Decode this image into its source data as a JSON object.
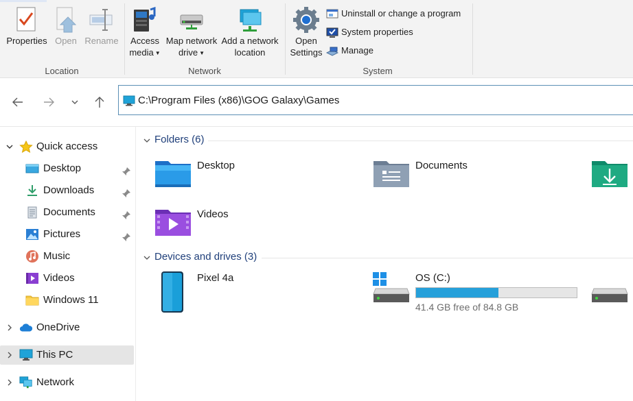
{
  "ribbon": {
    "location": {
      "label": "Location",
      "properties": "Properties",
      "open": "Open",
      "rename": "Rename"
    },
    "network": {
      "label": "Network",
      "access_media_1": "Access",
      "access_media_2": "media",
      "map_drive_1": "Map network",
      "map_drive_2": "drive",
      "add_location_1": "Add a network",
      "add_location_2": "location"
    },
    "system": {
      "label": "System",
      "open_settings_1": "Open",
      "open_settings_2": "Settings",
      "uninstall": "Uninstall or change a program",
      "system_properties": "System properties",
      "manage": "Manage"
    }
  },
  "address": {
    "path": "C:\\Program Files (x86)\\GOG Galaxy\\Games"
  },
  "nav": {
    "quick_access": "Quick access",
    "items": [
      {
        "label": "Desktop",
        "icon": "desktop-icon",
        "pinned": true
      },
      {
        "label": "Downloads",
        "icon": "downloads-icon",
        "pinned": true
      },
      {
        "label": "Documents",
        "icon": "documents-icon",
        "pinned": true
      },
      {
        "label": "Pictures",
        "icon": "pictures-icon",
        "pinned": true
      },
      {
        "label": "Music",
        "icon": "music-icon",
        "pinned": false
      },
      {
        "label": "Videos",
        "icon": "videos-icon",
        "pinned": false
      },
      {
        "label": "Windows 11",
        "icon": "folder-icon",
        "pinned": false
      }
    ],
    "onedrive": "OneDrive",
    "this_pc": "This PC",
    "network": "Network"
  },
  "content": {
    "folders_header": "Folders (6)",
    "folders": [
      {
        "name": "Desktop"
      },
      {
        "name": "Documents"
      },
      {
        "name": "Videos"
      }
    ],
    "drives_header": "Devices and drives (3)",
    "devices": [
      {
        "name": "Pixel 4a"
      }
    ],
    "drive_c": {
      "name": "OS (C:)",
      "free_text": "41.4 GB free of 84.8 GB",
      "used_fraction": 0.512
    }
  },
  "colors": {
    "accent": "#26a0da",
    "selected_bg": "#e5e5e5",
    "section_header": "#1f3f7a"
  }
}
